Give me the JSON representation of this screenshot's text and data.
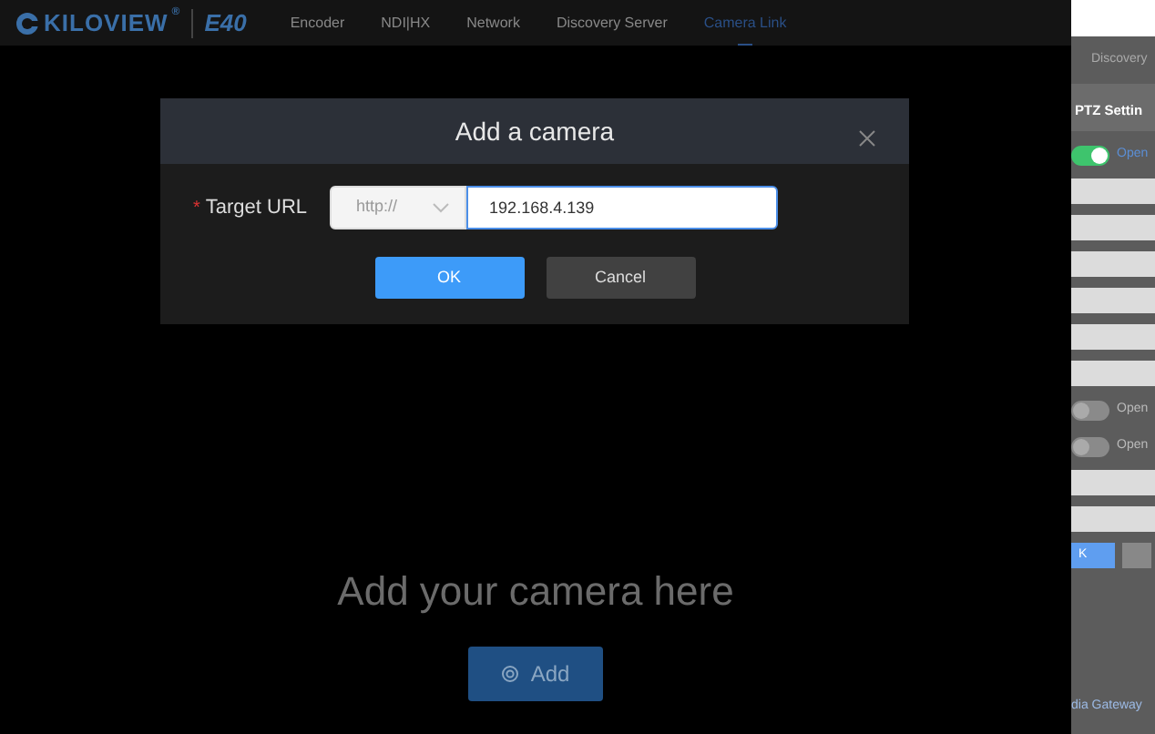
{
  "brand": {
    "logo": "KILOVIEW",
    "registered": "®",
    "model": "E40"
  },
  "nav": [
    {
      "label": "Encoder",
      "selected": false
    },
    {
      "label": "NDI|HX",
      "selected": false
    },
    {
      "label": "Network",
      "selected": false
    },
    {
      "label": "Discovery Server",
      "selected": false
    },
    {
      "label": "Camera Link",
      "selected": true
    }
  ],
  "empty_state": {
    "text": "Add your camera here",
    "button": "Add"
  },
  "dialog": {
    "title": "Add a camera",
    "required_mark": "*",
    "label": "Target URL",
    "protocol": "http://",
    "url": "192.168.4.139",
    "ok": "OK",
    "cancel": "Cancel"
  },
  "side_panel": {
    "title": "Discovery",
    "section": "PTZ Settin",
    "rows": [
      {
        "kind": "toggle",
        "on": true,
        "label": "Open"
      },
      {
        "kind": "field"
      },
      {
        "kind": "field"
      },
      {
        "kind": "field"
      },
      {
        "kind": "field"
      },
      {
        "kind": "field"
      },
      {
        "kind": "field"
      },
      {
        "kind": "toggle",
        "on": false,
        "label": "Open"
      },
      {
        "kind": "toggle",
        "on": false,
        "label": "Open"
      },
      {
        "kind": "field"
      },
      {
        "kind": "field"
      },
      {
        "kind": "buttons",
        "label": "K"
      }
    ],
    "footer": "dia Gateway"
  }
}
